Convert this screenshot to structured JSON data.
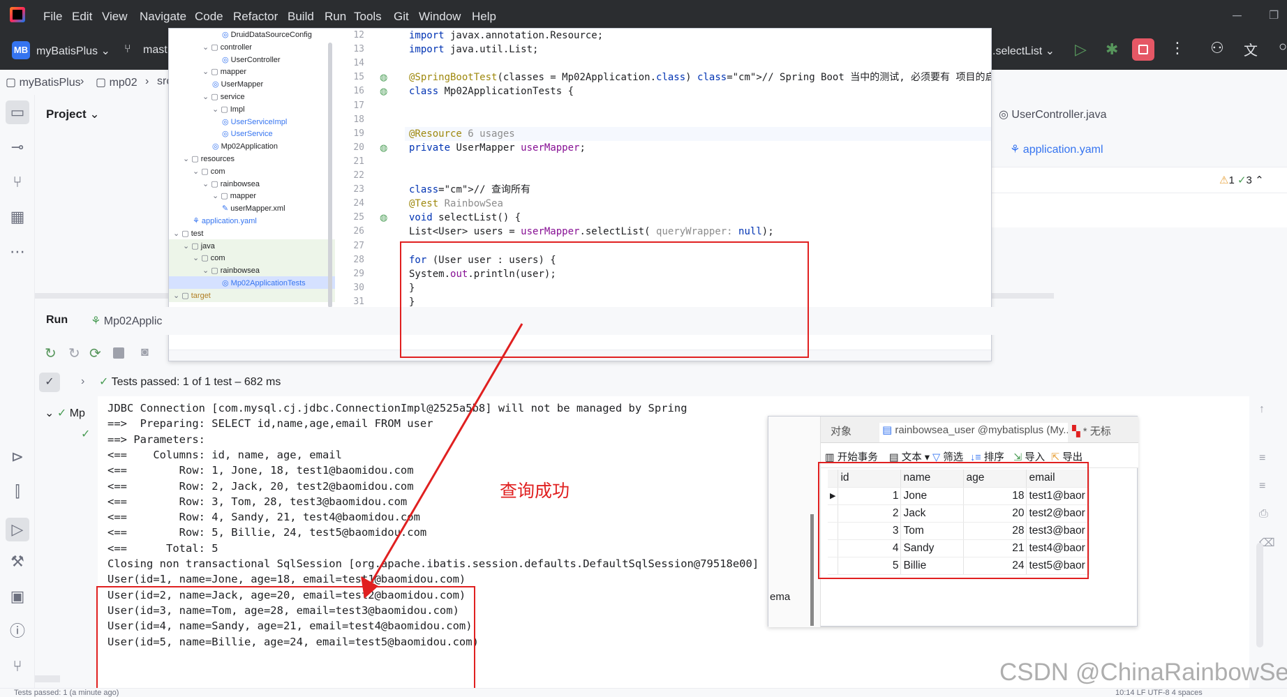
{
  "menu": [
    "File",
    "Edit",
    "View",
    "Navigate",
    "Code",
    "Refactor",
    "Build",
    "Run",
    "Tools",
    "Git",
    "Window",
    "Help"
  ],
  "toolbar": {
    "project_badge": "MB",
    "project_name": "myBatisPlus",
    "branch": "mast",
    "run_config": ".selectList"
  },
  "breadcrumb": [
    "myBatisPlus",
    "mp02",
    "src"
  ],
  "project_panel": {
    "title": "Project"
  },
  "tree": [
    {
      "label": "DruidDataSourceConfig",
      "indent": 5
    },
    {
      "label": "controller",
      "indent": 3
    },
    {
      "label": "UserController",
      "indent": 5
    },
    {
      "label": "mapper",
      "indent": 3
    },
    {
      "label": "UserMapper",
      "indent": 4
    },
    {
      "label": "service",
      "indent": 3
    },
    {
      "label": "Impl",
      "indent": 4
    },
    {
      "label": "UserServiceImpl",
      "indent": 5
    },
    {
      "label": "UserService",
      "indent": 5
    },
    {
      "label": "Mp02Application",
      "indent": 4
    },
    {
      "label": "resources",
      "indent": 1
    },
    {
      "label": "com",
      "indent": 2
    },
    {
      "label": "rainbowsea",
      "indent": 3
    },
    {
      "label": "mapper",
      "indent": 4
    },
    {
      "label": "userMapper.xml",
      "indent": 5
    },
    {
      "label": "application.yaml",
      "indent": 2
    },
    {
      "label": "test",
      "indent": 0
    },
    {
      "label": "java",
      "indent": 1
    },
    {
      "label": "com",
      "indent": 2
    },
    {
      "label": "rainbowsea",
      "indent": 3
    },
    {
      "label": "Mp02ApplicationTests",
      "indent": 5
    },
    {
      "label": "target",
      "indent": 0
    }
  ],
  "code_lines": [
    {
      "n": "12",
      "t": "import javax.annotation.Resource;"
    },
    {
      "n": "13",
      "t": "import java.util.List;"
    },
    {
      "n": "14",
      "t": ""
    },
    {
      "n": "15",
      "t": "@SpringBootTest(classes = Mp02Application.class)  // Spring Boot 当中的测试, 必须要有 项目的启动场景, 不"
    },
    {
      "n": "16",
      "t": "class Mp02ApplicationTests {"
    },
    {
      "n": "17",
      "t": ""
    },
    {
      "n": "18",
      "t": ""
    },
    {
      "n": "19",
      "t": "    @Resource  6 usages"
    },
    {
      "n": "20",
      "t": "    private UserMapper userMapper;"
    },
    {
      "n": "21",
      "t": ""
    },
    {
      "n": "22",
      "t": ""
    },
    {
      "n": "23",
      "t": "    // 查询所有"
    },
    {
      "n": "24",
      "t": "    @Test  RainbowSea"
    },
    {
      "n": "25",
      "t": "    void selectList() {"
    },
    {
      "n": "26",
      "t": "        List<User> users = userMapper.selectList( queryWrapper: null);"
    },
    {
      "n": "27",
      "t": ""
    },
    {
      "n": "28",
      "t": "        for (User user : users) {"
    },
    {
      "n": "29",
      "t": "            System.out.println(user);"
    },
    {
      "n": "30",
      "t": "        }"
    },
    {
      "n": "31",
      "t": "    }"
    }
  ],
  "right_files": [
    "UserController.java",
    "application.yaml"
  ],
  "inspections": {
    "warnings": "1",
    "ok": "3"
  },
  "run": {
    "title": "Run",
    "config": "Mp02Applic",
    "tree_item": "Mp",
    "tests_passed": "Tests passed: 1 of 1 test – 682 ms"
  },
  "console": [
    "JDBC Connection [com.mysql.cj.jdbc.ConnectionImpl@2525a5b8] will not be managed by Spring",
    "==>  Preparing: SELECT id,name,age,email FROM user",
    "==> Parameters: ",
    "<==    Columns: id, name, age, email",
    "<==        Row: 1, Jone, 18, test1@baomidou.com",
    "<==        Row: 2, Jack, 20, test2@baomidou.com",
    "<==        Row: 3, Tom, 28, test3@baomidou.com",
    "<==        Row: 4, Sandy, 21, test4@baomidou.com",
    "<==        Row: 5, Billie, 24, test5@baomidou.com",
    "<==      Total: 5",
    "Closing non transactional SqlSession [org.apache.ibatis.session.defaults.DefaultSqlSession@79518e00]",
    "User(id=1, name=Jone, age=18, email=test1@baomidou.com)",
    "User(id=2, name=Jack, age=20, email=test2@baomidou.com)",
    "User(id=3, name=Tom, age=28, email=test3@baomidou.com)",
    "User(id=4, name=Sandy, age=21, email=test4@baomidou.com)",
    "User(id=5, name=Billie, age=24, email=test5@baomidou.com)"
  ],
  "annotation": "查询成功",
  "db": {
    "tab_object": "对象",
    "tab_table": "rainbowsea_user @mybatisplus (My...",
    "tab_new": "* 无标",
    "tools": [
      "开始事务",
      "文本",
      "筛选",
      "排序",
      "导入",
      "导出"
    ],
    "columns": [
      "id",
      "name",
      "age",
      "email"
    ],
    "rows": [
      [
        "1",
        "Jone",
        "18",
        "test1@baor"
      ],
      [
        "2",
        "Jack",
        "20",
        "test2@baor"
      ],
      [
        "3",
        "Tom",
        "28",
        "test3@baor"
      ],
      [
        "4",
        "Sandy",
        "21",
        "test4@baor"
      ],
      [
        "5",
        "Billie",
        "24",
        "test5@baor"
      ]
    ],
    "side_label": "ema"
  },
  "status": {
    "left": "Tests passed: 1 (a minute ago)",
    "right": "10:14   LF   UTF-8   4 spaces"
  },
  "watermark": "CSDN @ChinaRainbowSea",
  "colors": {
    "accent": "#3574f0",
    "red": "#e02020",
    "green": "#499c54"
  }
}
